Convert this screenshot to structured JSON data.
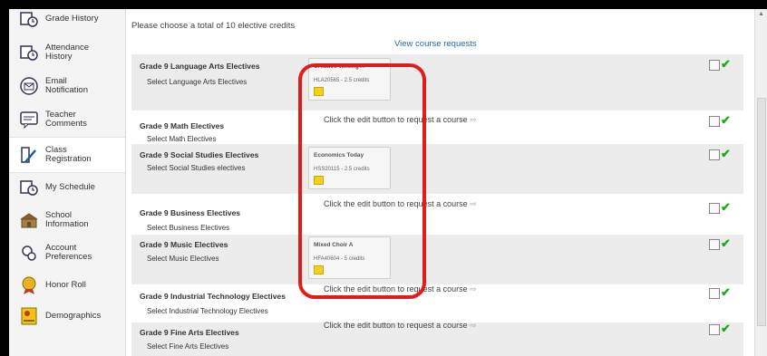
{
  "sidebar": {
    "items": [
      {
        "label": "Grade History",
        "icon": "grade-history-icon"
      },
      {
        "label": "Attendance History",
        "icon": "attendance-icon"
      },
      {
        "label": "Email Notification",
        "icon": "email-icon"
      },
      {
        "label": "Teacher Comments",
        "icon": "comments-icon"
      },
      {
        "label": "Class Registration",
        "icon": "registration-icon",
        "active": true
      },
      {
        "label": "My Schedule",
        "icon": "schedule-icon"
      },
      {
        "label": "School Information",
        "icon": "school-icon"
      },
      {
        "label": "Account Preferences",
        "icon": "preferences-icon"
      },
      {
        "label": "Honor Roll",
        "icon": "honor-roll-icon"
      },
      {
        "label": "Demographics",
        "icon": "demographics-icon"
      }
    ]
  },
  "main": {
    "instruction": "Please choose a total of 10 elective credits",
    "view_link": "View course requests",
    "prompt_text": "Click the edit button to request a course",
    "rows": [
      {
        "title": "Grade 9 Language Arts Electives",
        "sub": "Select Language Arts Electives",
        "course": {
          "name": "Creative Writing A",
          "code": "HLA20565 - 2.5 credits"
        }
      },
      {
        "title": "Grade 9 Math Electives",
        "sub": "Select Math Electives"
      },
      {
        "title": "Grade 9 Social Studies Electives",
        "sub": "Select Social Studies electives",
        "course": {
          "name": "Economics Today",
          "code": "HSS20115 - 2.5 credits"
        }
      },
      {
        "title": "Grade 9 Business Electives",
        "sub": "Select Business Electives"
      },
      {
        "title": "Grade 9 Music Electives",
        "sub": "Select Music Electives",
        "course": {
          "name": "Mixed Choir A",
          "code": "HFA40604 - 5 credits"
        }
      },
      {
        "title": "Grade 9 Industrial Technology Electives",
        "sub": "Select Industrial Technology Electives"
      },
      {
        "title": "Grade 9 Fine Arts Electives",
        "sub": "Select Fine Arts Electives"
      }
    ]
  },
  "colors": {
    "accent_link": "#2a6aa8",
    "highlight_box": "#e01c1c",
    "check": "#1fa91f"
  }
}
